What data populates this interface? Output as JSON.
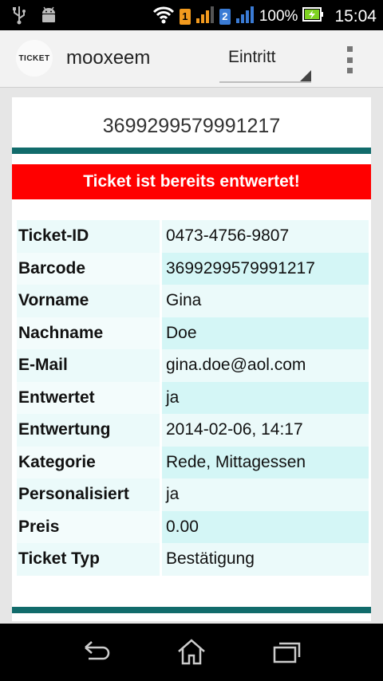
{
  "status_bar": {
    "usb_icon": "usb-icon",
    "android_icon": "android-debug-icon",
    "sim1": "1",
    "sim2": "2",
    "battery": "100%",
    "time": "15:04",
    "sim1_color": "#f29a1e",
    "sim2_color": "#3a7bd5"
  },
  "action_bar": {
    "logo_text": "TICKET",
    "title": "mooxeem",
    "spinner_value": "Eintritt"
  },
  "barcode_field": {
    "value": "3699299579991217"
  },
  "alert": {
    "text": "Ticket ist bereits entwertet!",
    "color": "#ff0000"
  },
  "details": [
    {
      "label": "Ticket-ID",
      "value": "0473-4756-9807"
    },
    {
      "label": "Barcode",
      "value": "3699299579991217"
    },
    {
      "label": "Vorname",
      "value": "Gina"
    },
    {
      "label": "Nachname",
      "value": "Doe"
    },
    {
      "label": "E-Mail",
      "value": "gina.doe@aol.com"
    },
    {
      "label": "Entwertet",
      "value": "ja"
    },
    {
      "label": "Entwertung",
      "value": "2014-02-06, 14:17"
    },
    {
      "label": "Kategorie",
      "value": "Rede, Mittagessen"
    },
    {
      "label": "Personalisiert",
      "value": "ja"
    },
    {
      "label": "Preis",
      "value": "0.00"
    },
    {
      "label": "Ticket Typ",
      "value": "Bestätigung"
    }
  ],
  "accent_color": "#116b6b",
  "nav": {
    "back_icon": "back-icon",
    "home_icon": "home-icon",
    "recents_icon": "recent-apps-icon"
  }
}
